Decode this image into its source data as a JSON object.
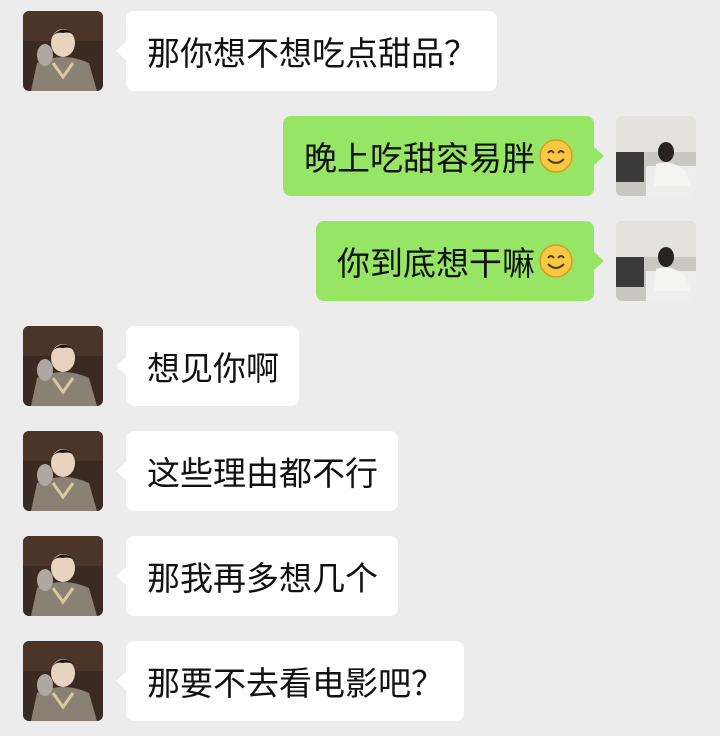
{
  "chat": {
    "messages": [
      {
        "side": "left",
        "text": "那你想不想吃点甜品？",
        "emoji": null
      },
      {
        "side": "right",
        "text": "晚上吃甜容易胖",
        "emoji": "smiling-face-icon"
      },
      {
        "side": "right",
        "text": "你到底想干嘛",
        "emoji": "smiling-face-icon"
      },
      {
        "side": "left",
        "text": "想见你啊",
        "emoji": null
      },
      {
        "side": "left",
        "text": "这些理由都不行",
        "emoji": null
      },
      {
        "side": "left",
        "text": "那我再多想几个",
        "emoji": null
      },
      {
        "side": "left",
        "text": "那要不去看电影吧？",
        "emoji": null
      }
    ]
  },
  "colors": {
    "background": "#ececec",
    "incoming_bubble": "#ffffff",
    "outgoing_bubble": "#96e564",
    "text": "#111111"
  }
}
